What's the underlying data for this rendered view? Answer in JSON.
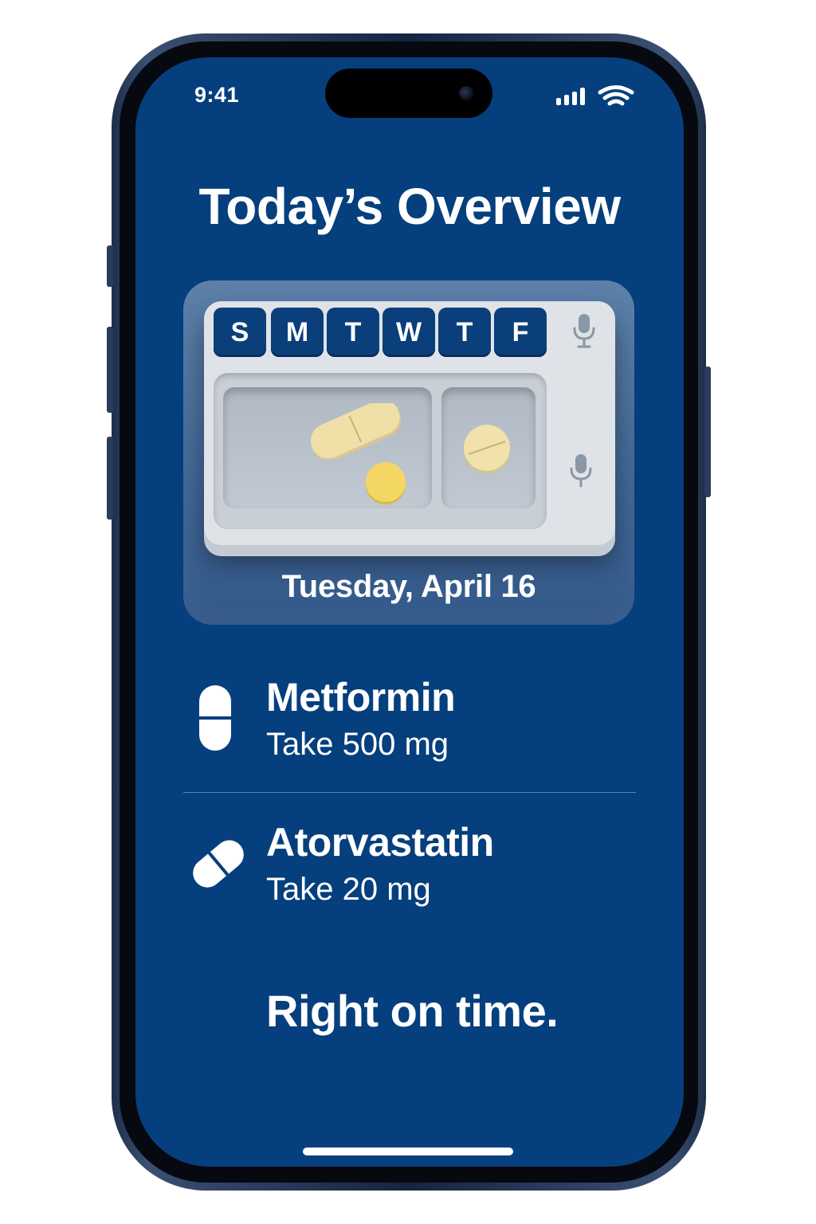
{
  "status_bar": {
    "time": "9:41",
    "icons": [
      "cellular-signal-icon",
      "wifi-icon"
    ]
  },
  "header": {
    "title": "Today’s Overview"
  },
  "organizer_card": {
    "days": [
      "S",
      "M",
      "T",
      "W",
      "T",
      "F"
    ],
    "icons": [
      "microphone-icon",
      "microphone-icon"
    ],
    "date": "Tuesday, April 16"
  },
  "medications": [
    {
      "name": "Metformin",
      "dose": "Take 500 mg",
      "icon": "capsule-icon"
    },
    {
      "name": "Atorvastatin",
      "dose": "Take 20 mg",
      "icon": "pill-icon"
    }
  ],
  "footer": {
    "tagline": "Right on time."
  },
  "colors": {
    "screen_background": "#063f7d",
    "card_background": "#4a7099",
    "day_key": "#0b3f7b",
    "text": "#ffffff",
    "pill_cream": "#f0dfa6",
    "pill_yellow": "#f4d763"
  }
}
